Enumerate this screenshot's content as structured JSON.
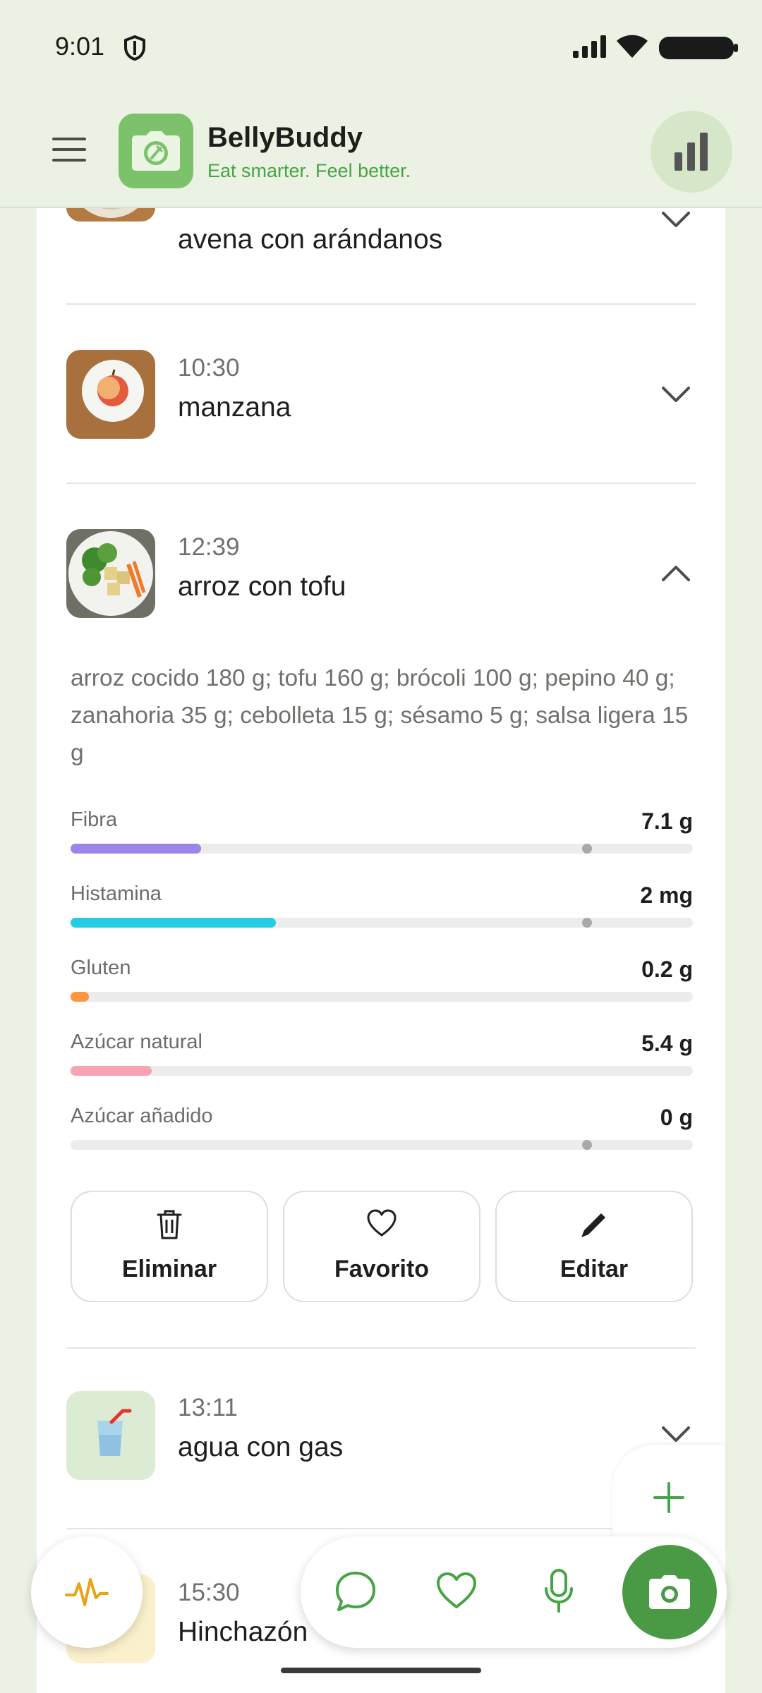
{
  "status_bar": {
    "time": "9:01"
  },
  "app": {
    "title": "BellyBuddy",
    "tagline": "Eat smarter. Feel better.",
    "accent_color": "#47a446"
  },
  "meals": [
    {
      "time": "",
      "name": "avena con arándanos",
      "thumb": "oatmeal-blueberries-photo",
      "expanded": false
    },
    {
      "time": "10:30",
      "name": "manzana",
      "thumb": "apple-photo",
      "expanded": false
    },
    {
      "time": "12:39",
      "name": "arroz con tofu",
      "thumb": "rice-tofu-bowl-photo",
      "expanded": true,
      "ingredients": "arroz cocido 180 g; tofu 160 g; brócoli 100 g; pepino 40 g; zanahoria 35 g; cebolleta 15 g; sésamo 5 g; salsa ligera 15 g",
      "nutrients": [
        {
          "label": "Fibra",
          "value": "7.1 g",
          "fill_fraction": 0.21,
          "color": "#9d84ea",
          "has_marker": true,
          "marker_fraction": 0.83
        },
        {
          "label": "Histamina",
          "value": "2 mg",
          "fill_fraction": 0.33,
          "color": "#25cde3",
          "has_marker": true,
          "marker_fraction": 0.83
        },
        {
          "label": "Gluten",
          "value": "0.2 g",
          "fill_fraction": 0.03,
          "color": "#fb963f",
          "has_marker": false
        },
        {
          "label": "Azúcar natural",
          "value": "5.4 g",
          "fill_fraction": 0.13,
          "color": "#f6a4b4",
          "has_marker": false
        },
        {
          "label": "Azúcar añadido",
          "value": "0 g",
          "fill_fraction": 0,
          "color": "#cccccc",
          "has_marker": true,
          "marker_fraction": 0.83
        }
      ],
      "actions": {
        "delete": "Eliminar",
        "favorite": "Favorito",
        "edit": "Editar"
      }
    },
    {
      "time": "13:11",
      "name": "agua con gas",
      "thumb": "glass-drink-icon",
      "expanded": false
    },
    {
      "time": "15:30",
      "name": "Hinchazón",
      "thumb": "symptom-icon",
      "expanded": false
    }
  ],
  "bottom_nav": {
    "items": [
      "pulse-icon",
      "chat-icon",
      "heart-icon",
      "microphone-icon",
      "camera-icon"
    ]
  }
}
